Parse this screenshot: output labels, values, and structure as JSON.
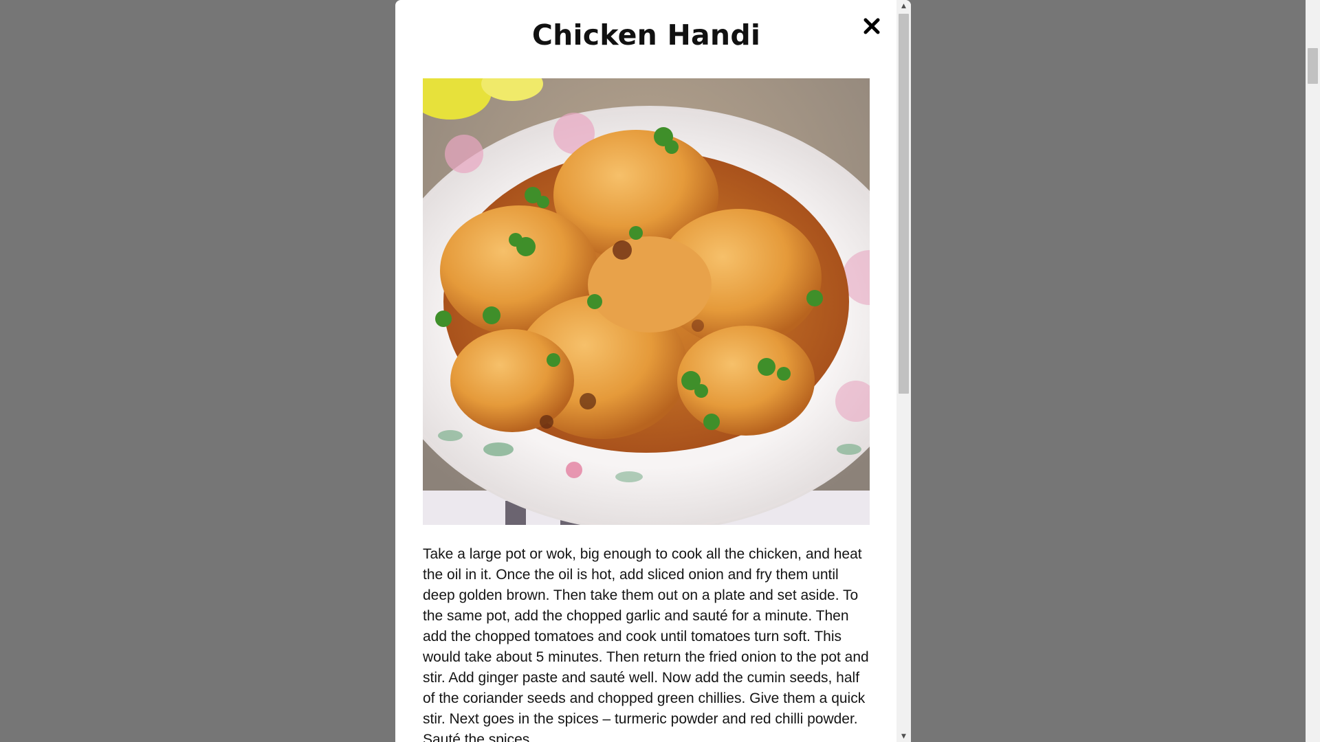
{
  "modal": {
    "title": "Chicken Handi",
    "close_icon": "close-icon",
    "image_alt": "recipe-photo",
    "instructions": "Take a large pot or wok, big enough to cook all the chicken, and heat the oil in it. Once the oil is hot, add sliced onion and fry them until deep golden brown. Then take them out on a plate and set aside. To the same pot, add the chopped garlic and sauté for a minute. Then add the chopped tomatoes and cook until tomatoes turn soft. This would take about 5 minutes. Then return the fried onion to the pot and stir. Add ginger paste and sauté well. Now add the cumin seeds, half of the coriander seeds and chopped green chillies. Give them a quick stir. Next goes in the spices – turmeric powder and red chilli powder. Sauté the spices"
  },
  "colors": {
    "backdrop": "#767676",
    "modal_background": "#ffffff",
    "scrollbar_track": "#f1f1f1",
    "scrollbar_thumb": "#c1c1c1"
  }
}
